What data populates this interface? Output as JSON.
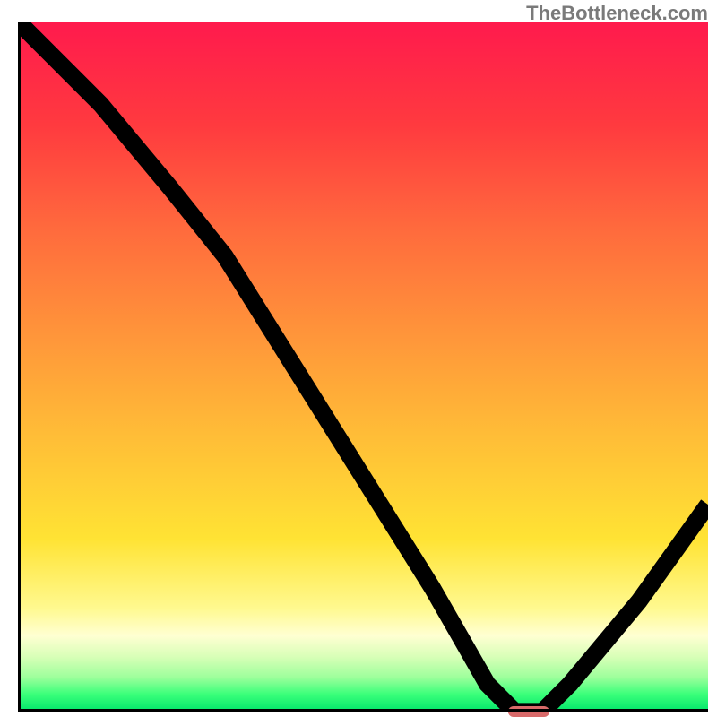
{
  "watermark": "TheBottleneck.com",
  "chart_data": {
    "type": "line",
    "title": "",
    "xlabel": "",
    "ylabel": "",
    "xlim": [
      0,
      100
    ],
    "ylim": [
      0,
      100
    ],
    "grid": false,
    "legend": false,
    "background": "red-to-green vertical gradient (bottleneck severity)",
    "series": [
      {
        "name": "bottleneck-curve",
        "x": [
          0,
          12,
          22,
          30,
          40,
          50,
          60,
          68,
          72,
          76,
          80,
          90,
          100
        ],
        "values": [
          100,
          88,
          76,
          66,
          50,
          34,
          18,
          4,
          0,
          0,
          4,
          16,
          30
        ]
      }
    ],
    "optimum_marker": {
      "x_start": 71,
      "x_end": 77,
      "y": 0
    },
    "colors": {
      "curve": "#000000",
      "marker": "#d86a6a",
      "gradient_top": "#ff1a4d",
      "gradient_bottom": "#00e56a"
    }
  }
}
